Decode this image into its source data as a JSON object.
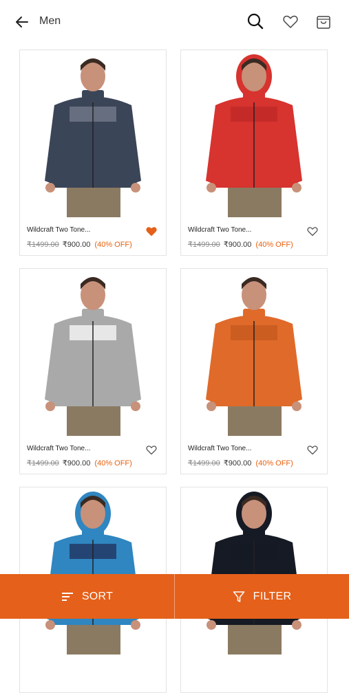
{
  "header": {
    "title": "Men"
  },
  "icons": {
    "back": "arrow-left-icon",
    "search": "search-icon",
    "wishlist": "heart-icon",
    "bag": "shopping-bag-icon"
  },
  "products": [
    {
      "name": "Wildcraft Two Tone...",
      "mrp": "₹1499.00",
      "price": "₹900.00",
      "discount": "(40% OFF)",
      "wishlisted": true,
      "jacket": "#3b4558",
      "accent": "#6e7686"
    },
    {
      "name": "Wildcraft Two Tone...",
      "mrp": "₹1499.00",
      "price": "₹900.00",
      "discount": "(40% OFF)",
      "wishlisted": false,
      "jacket": "#d7332f",
      "accent": "#c12a27"
    },
    {
      "name": "Wildcraft Two Tone...",
      "mrp": "₹1499.00",
      "price": "₹900.00",
      "discount": "(40% OFF)",
      "wishlisted": false,
      "jacket": "#a9a9a9",
      "accent": "#f2f2f2"
    },
    {
      "name": "Wildcraft Two Tone...",
      "mrp": "₹1499.00",
      "price": "₹900.00",
      "discount": "(40% OFF)",
      "wishlisted": false,
      "jacket": "#e06a2a",
      "accent": "#c85a20"
    },
    {
      "name": "",
      "mrp": "",
      "price": "",
      "discount": "",
      "wishlisted": false,
      "jacket": "#2f86c0",
      "accent": "#223a66"
    },
    {
      "name": "",
      "mrp": "",
      "price": "",
      "discount": "",
      "wishlisted": false,
      "jacket": "#151a24",
      "accent": "#151a24"
    }
  ],
  "actions": {
    "sort_label": "SORT",
    "filter_label": "FILTER"
  },
  "colors": {
    "accent": "#e5601a",
    "discount": "#e8600e",
    "heart_active": "#e5601a"
  }
}
